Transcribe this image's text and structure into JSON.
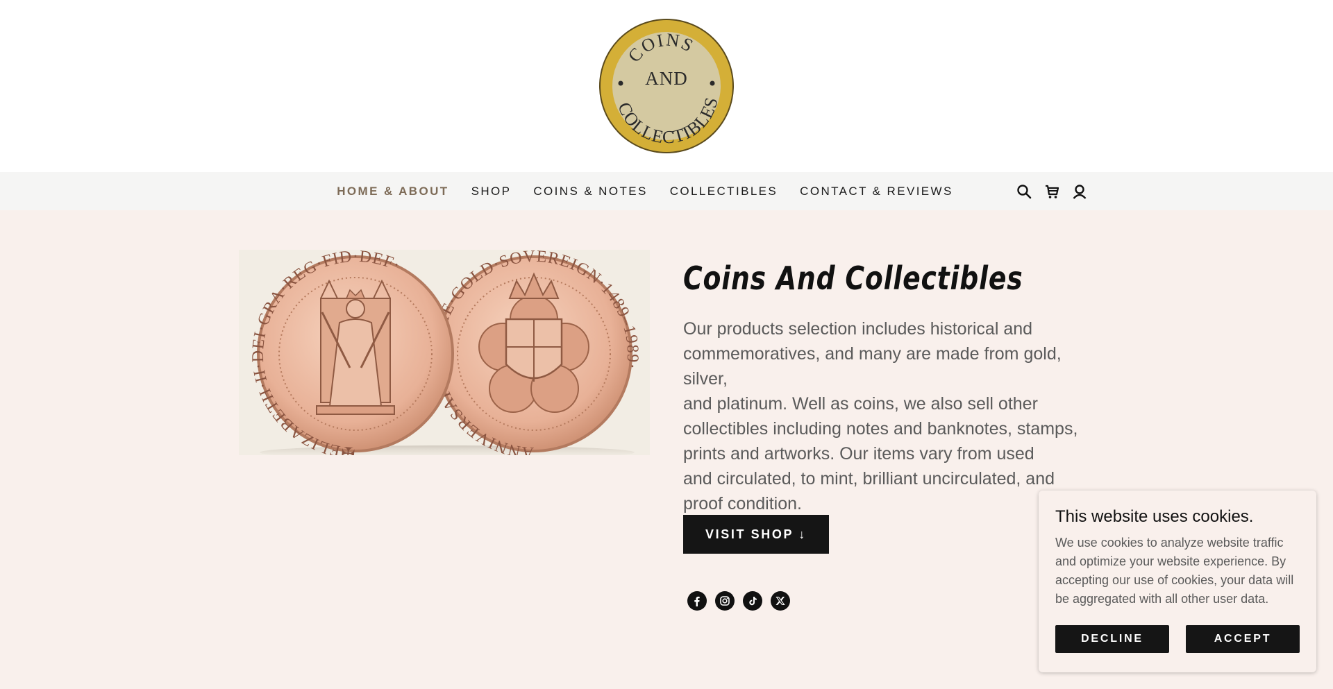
{
  "logo": {
    "top_text": "COINS",
    "middle_text": "AND",
    "bottom_text": "COLLECTIBLES",
    "ring_color": "#d4af37",
    "inner_color": "#d4c9a1"
  },
  "nav": {
    "items": [
      {
        "label": "HOME & ABOUT",
        "active": true
      },
      {
        "label": "SHOP",
        "active": false
      },
      {
        "label": "COINS & NOTES",
        "active": false
      },
      {
        "label": "COLLECTIBLES",
        "active": false
      },
      {
        "label": "CONTACT & REVIEWS",
        "active": false
      }
    ],
    "icons": [
      "search-icon",
      "cart-icon",
      "account-icon"
    ]
  },
  "hero": {
    "title": "Coins And Collectibles",
    "body_lines": [
      "Our products selection includes historical and",
      "commemoratives, and many are made from gold, silver,",
      "and platinum. Well as coins, we also sell other",
      "collectibles including notes and banknotes, stamps,",
      "prints and artworks. Our items vary from used",
      "and circulated, to mint, brilliant uncirculated, and",
      "proof condition."
    ],
    "button_label": "VISIT SHOP ↓",
    "coin_left_legend": "✠ELIZABETH·II·DEI·GRA·REG·FID·DEF·",
    "coin_right_legend": "ANNIVERSARY·OF·THE·GOLD·SOVEREIGN·1489–1989·",
    "background": "#f9f0ec"
  },
  "social": [
    "facebook-icon",
    "instagram-icon",
    "tiktok-icon",
    "x-icon"
  ],
  "cookie": {
    "title": "This website uses cookies.",
    "text": "We use cookies to analyze website traffic and optimize your website experience. By accepting our use of cookies, your data will be aggregated with all other user data.",
    "decline_label": "DECLINE",
    "accept_label": "ACCEPT"
  },
  "colors": {
    "accent_nav_active": "#7d6b57",
    "button_dark": "#151515",
    "coin_gold_rose": "#e8b197"
  }
}
